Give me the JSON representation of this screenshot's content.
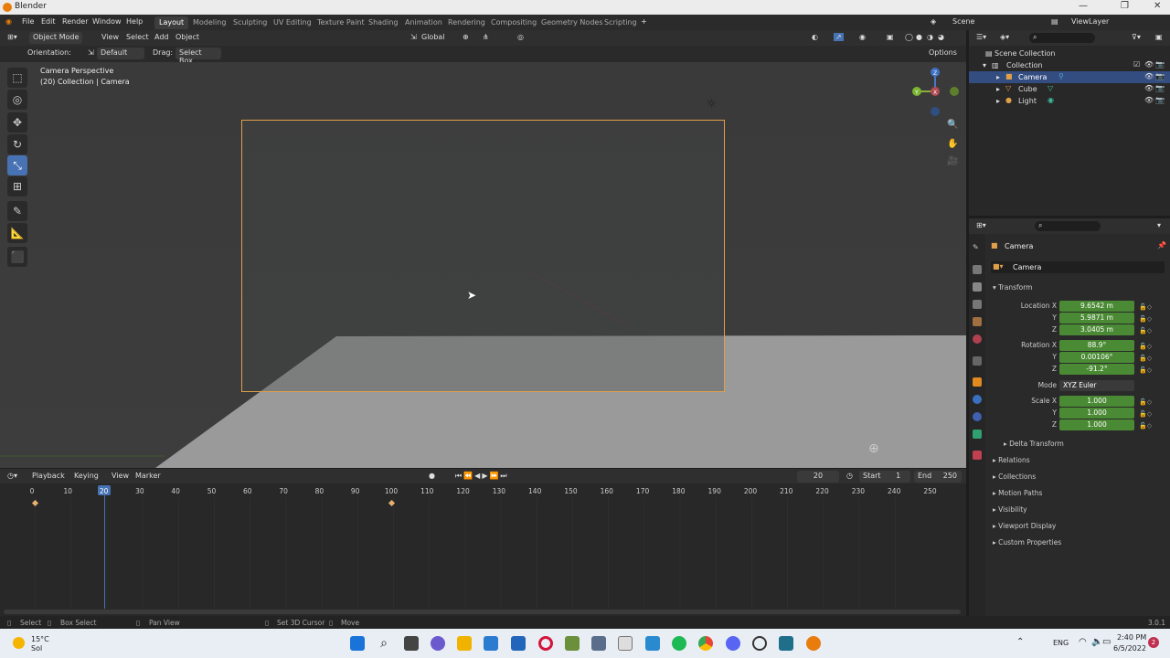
{
  "window": {
    "title": "Blender"
  },
  "menu": {
    "items": [
      "File",
      "Edit",
      "Render",
      "Window",
      "Help"
    ],
    "workspaces": [
      "Layout",
      "Modeling",
      "Sculpting",
      "UV Editing",
      "Texture Paint",
      "Shading",
      "Animation",
      "Rendering",
      "Compositing",
      "Geometry Nodes",
      "Scripting"
    ],
    "active_workspace": "Layout",
    "add_tab": "+",
    "scene": "Scene",
    "view_layer": "ViewLayer"
  },
  "viewport_header": {
    "mode": "Object Mode",
    "menus": [
      "View",
      "Select",
      "Add",
      "Object"
    ],
    "transform_orientation": "Global",
    "orientation_label": "Orientation:",
    "orientation_value": "Default",
    "drag_label": "Drag:",
    "drag_value": "Select Box",
    "options": "Options"
  },
  "viewport": {
    "view_name": "Camera Perspective",
    "view_info": "(20) Collection | Camera",
    "gizmo": {
      "x": "X",
      "y": "Y",
      "z": "Z"
    }
  },
  "outliner": {
    "root": "Scene Collection",
    "collection": "Collection",
    "objects": [
      {
        "name": "Camera",
        "selected": true
      },
      {
        "name": "Cube",
        "selected": false
      },
      {
        "name": "Light",
        "selected": false
      }
    ]
  },
  "properties": {
    "object_name": "Camera",
    "datablock": "Camera",
    "transform_label": "Transform",
    "location_label": "Location X",
    "location": [
      "9.6542 m",
      "5.9871 m",
      "3.0405 m"
    ],
    "rotation_label": "Rotation X",
    "rotation": [
      "88.9°",
      "0.00106°",
      "-91.2°"
    ],
    "mode_label": "Mode",
    "mode_value": "XYZ Euler",
    "scale_label": "Scale X",
    "scale": [
      "1.000",
      "1.000",
      "1.000"
    ],
    "axis_y": "Y",
    "axis_z": "Z",
    "panels": [
      "Delta Transform",
      "Relations",
      "Collections",
      "Motion Paths",
      "Visibility",
      "Viewport Display",
      "Custom Properties"
    ]
  },
  "timeline": {
    "menus": [
      "Playback",
      "Keying",
      "View",
      "Marker"
    ],
    "current_frame": "20",
    "start_label": "Start",
    "start": "1",
    "end_label": "End",
    "end": "250",
    "ticks": [
      "0",
      "10",
      "20",
      "30",
      "40",
      "50",
      "60",
      "70",
      "80",
      "90",
      "100",
      "110",
      "120",
      "130",
      "140",
      "150",
      "160",
      "170",
      "180",
      "190",
      "200",
      "210",
      "220",
      "230",
      "240",
      "250"
    ],
    "keyframes": [
      1,
      100
    ]
  },
  "statusbar": {
    "items": [
      "Select",
      "Box Select",
      "Pan View",
      "Set 3D Cursor",
      "Move"
    ],
    "version": "3.0.1"
  },
  "taskbar": {
    "temperature": "15°C",
    "weather": "Sol",
    "language": "ENG",
    "time": "2:40 PM",
    "date": "6/5/2022",
    "notifications": "2"
  },
  "colors": {
    "accent": "#4772b3",
    "field_green": "#4a8a34",
    "camera_frame": "#e0a04a",
    "selection": "#334d80"
  }
}
